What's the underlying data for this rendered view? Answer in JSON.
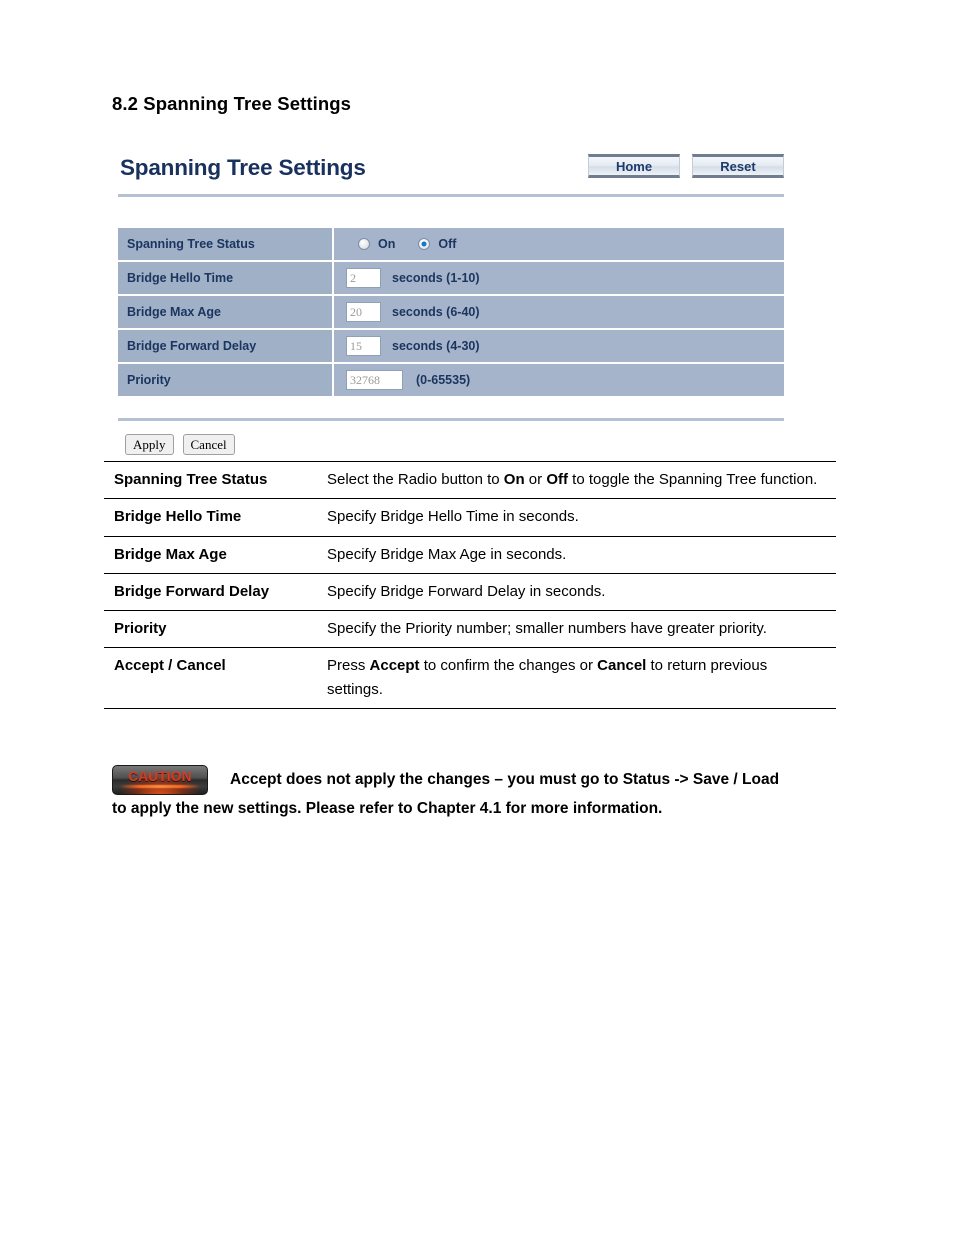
{
  "document": {
    "section_heading": "8.2 Spanning Tree Settings"
  },
  "ui_panel": {
    "title": "Spanning Tree Settings",
    "header_buttons": [
      {
        "label": "Home",
        "name": "home-button"
      },
      {
        "label": "Reset",
        "name": "reset-button"
      }
    ],
    "rows": {
      "status": {
        "label": "Spanning Tree Status",
        "options": [
          {
            "label": "On",
            "selected": false
          },
          {
            "label": "Off",
            "selected": true
          }
        ]
      },
      "hello_time": {
        "label": "Bridge Hello Time",
        "value": "2",
        "unit": "seconds (1-10)"
      },
      "max_age": {
        "label": "Bridge Max Age",
        "value": "20",
        "unit": "seconds (6-40)"
      },
      "forward_delay": {
        "label": "Bridge Forward Delay",
        "value": "15",
        "unit": "seconds (4-30)"
      },
      "priority": {
        "label": "Priority",
        "value": "32768",
        "unit": "(0-65535)"
      }
    },
    "form_actions": {
      "apply_label": "Apply",
      "cancel_label": "Cancel"
    },
    "colors": {
      "title_navy": "#19315e",
      "label_cell_bg": "#9fb0c7",
      "value_cell_bg": "#a5b4ca",
      "rule": "#b3c1d4",
      "radio_selected": "#1676c8"
    }
  },
  "description_table": {
    "rows": [
      {
        "term": "Spanning Tree Status",
        "text_parts": [
          {
            "t": "Select the Radio button to ",
            "b": false
          },
          {
            "t": "On",
            "b": true
          },
          {
            "t": " or ",
            "b": false
          },
          {
            "t": "Off",
            "b": true
          },
          {
            "t": " to toggle the Spanning Tree function.",
            "b": false
          }
        ]
      },
      {
        "term": "Bridge Hello Time",
        "text_parts": [
          {
            "t": "Specify Bridge Hello Time in seconds.",
            "b": false
          }
        ]
      },
      {
        "term": "Bridge Max Age",
        "text_parts": [
          {
            "t": "Specify Bridge Max Age in seconds.",
            "b": false
          }
        ]
      },
      {
        "term": "Bridge Forward Delay",
        "text_parts": [
          {
            "t": "Specify Bridge Forward Delay in seconds.",
            "b": false
          }
        ]
      },
      {
        "term": "Priority",
        "text_parts": [
          {
            "t": "Specify the Priority number; smaller numbers have greater priority.",
            "b": false
          }
        ]
      },
      {
        "term": "Accept / Cancel",
        "text_parts": [
          {
            "t": "Press ",
            "b": false
          },
          {
            "t": "Accept",
            "b": true
          },
          {
            "t": " to confirm the changes or ",
            "b": false
          },
          {
            "t": "Cancel",
            "b": true
          },
          {
            "t": " to return previous settings.",
            "b": false
          }
        ]
      }
    ]
  },
  "caution": {
    "badge_label": "CAUTION",
    "line1": "Accept does not apply the changes – you must go to Status -> Save / Load",
    "line2": "to apply the new settings. Please refer to Chapter 4.1 for more information."
  }
}
